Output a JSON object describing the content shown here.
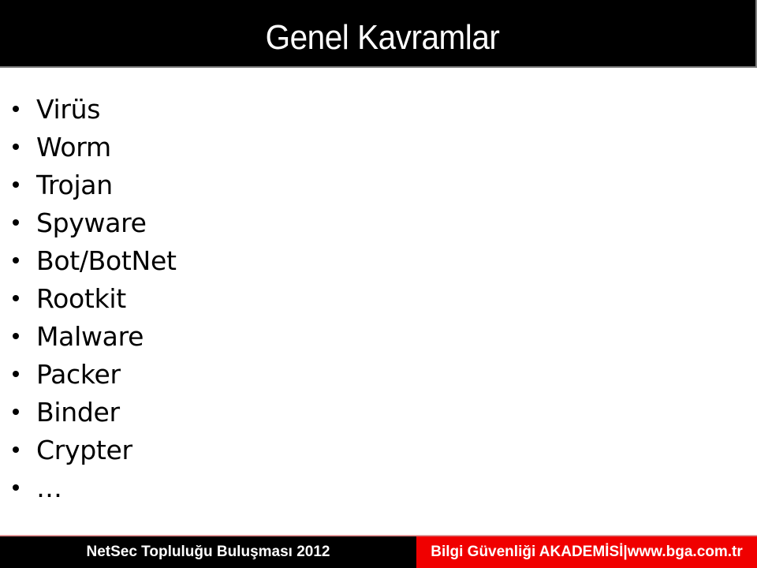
{
  "slide": {
    "title": "Genel Kavramlar",
    "bullets": [
      {
        "label": "Virüs"
      },
      {
        "label": "Worm"
      },
      {
        "label": "Trojan"
      },
      {
        "label": "Spyware"
      },
      {
        "label": "Bot/BotNet"
      },
      {
        "label": "Rootkit"
      },
      {
        "label": "Malware"
      },
      {
        "label": "Packer"
      },
      {
        "label": "Binder"
      },
      {
        "label": "Crypter"
      },
      {
        "label": "…"
      }
    ]
  },
  "footer": {
    "left_text": "NetSec Topluluğu Buluşması 2012",
    "right_text": "Bilgi Güvenliği AKADEMİSİ|www.bga.com.tr"
  },
  "colors": {
    "header_bg": "#000000",
    "footer_left_bg": "#000000",
    "footer_right_bg": "#f00000",
    "text_light": "#ffffff",
    "text_dark": "#000000"
  }
}
